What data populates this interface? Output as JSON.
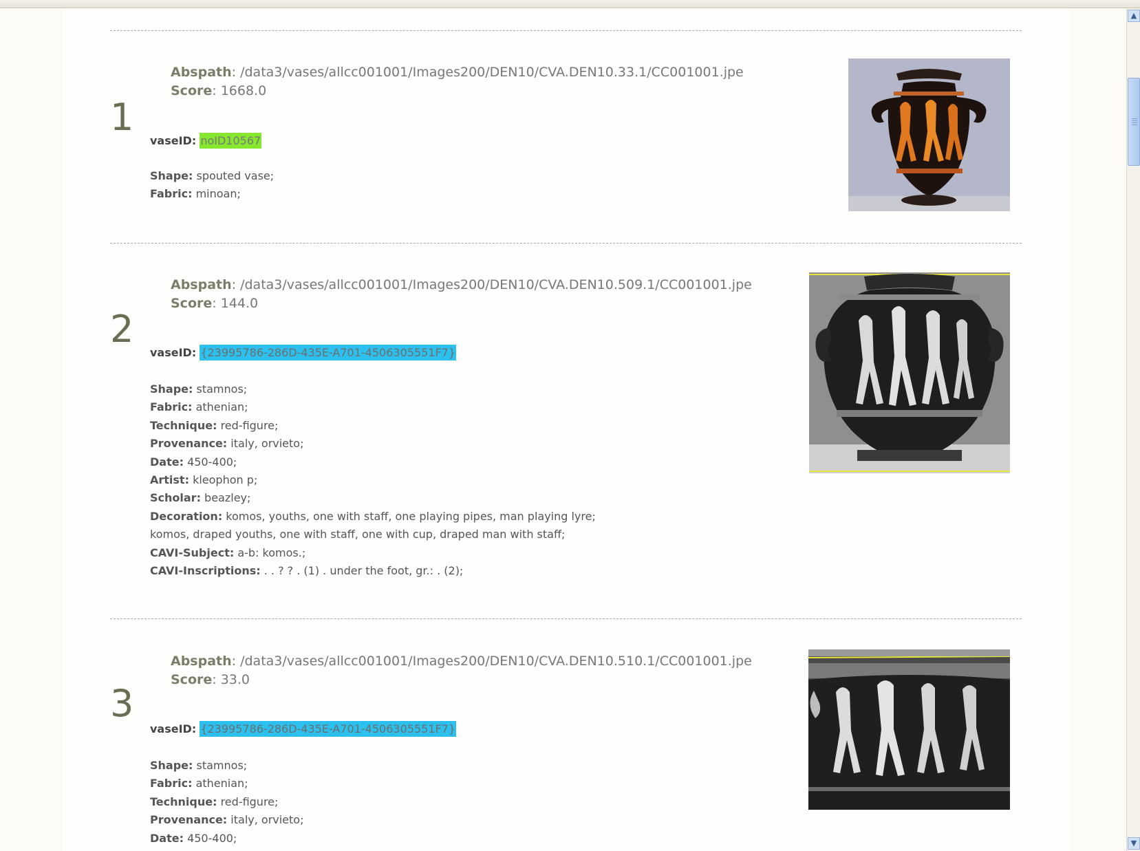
{
  "results": [
    {
      "rank": "1",
      "abspath_label": "Abspath",
      "abspath": ": /data3/vases/allcc001001/Images200/DEN10/CVA.DEN10.33.1/CC001001.jpe",
      "score_label": "Score",
      "score": ": 1668.0",
      "vaseid_label": "vaseID:",
      "vaseid": "noID10567",
      "vaseid_color": "#86e82e",
      "fields": [
        {
          "label": "Shape:",
          "value": " spouted vase;"
        },
        {
          "label": "Fabric:",
          "value": " minoan;"
        }
      ]
    },
    {
      "rank": "2",
      "abspath_label": "Abspath",
      "abspath": ": /data3/vases/allcc001001/Images200/DEN10/CVA.DEN10.509.1/CC001001.jpe",
      "score_label": "Score",
      "score": ": 144.0",
      "vaseid_label": "vaseID:",
      "vaseid": "{23995786-286D-435E-A701-4506305551F7}",
      "vaseid_color": "#2cc0ee",
      "fields": [
        {
          "label": "Shape:",
          "value": " stamnos;"
        },
        {
          "label": "Fabric:",
          "value": " athenian;"
        },
        {
          "label": "Technique:",
          "value": " red-figure;"
        },
        {
          "label": "Provenance:",
          "value": " italy, orvieto;"
        },
        {
          "label": "Date:",
          "value": " 450-400;"
        },
        {
          "label": "Artist:",
          "value": " kleophon p;"
        },
        {
          "label": "Scholar:",
          "value": " beazley;"
        },
        {
          "label": "Decoration:",
          "value": " komos, youths, one with staff, one playing pipes, man playing lyre;"
        },
        {
          "label": "",
          "value": "komos, draped youths, one with staff, one with cup, draped man with staff;"
        },
        {
          "label": "CAVI-Subject:",
          "value": " a-b: komos.;"
        },
        {
          "label": "CAVI-Inscriptions:",
          "value": " . . ? ? . (1) . under the foot, gr.: . (2);"
        }
      ]
    },
    {
      "rank": "3",
      "abspath_label": "Abspath",
      "abspath": ": /data3/vases/allcc001001/Images200/DEN10/CVA.DEN10.510.1/CC001001.jpe",
      "score_label": "Score",
      "score": ": 33.0",
      "vaseid_label": "vaseID:",
      "vaseid": "{23995786-286D-435E-A701-4506305551F7}",
      "vaseid_color": "#2cc0ee",
      "fields": [
        {
          "label": "Shape:",
          "value": " stamnos;"
        },
        {
          "label": "Fabric:",
          "value": " athenian;"
        },
        {
          "label": "Technique:",
          "value": " red-figure;"
        },
        {
          "label": "Provenance:",
          "value": " italy, orvieto;"
        },
        {
          "label": "Date:",
          "value": " 450-400;"
        }
      ]
    }
  ],
  "icons": {
    "scroll_up": "▲",
    "scroll_down": "▼"
  }
}
